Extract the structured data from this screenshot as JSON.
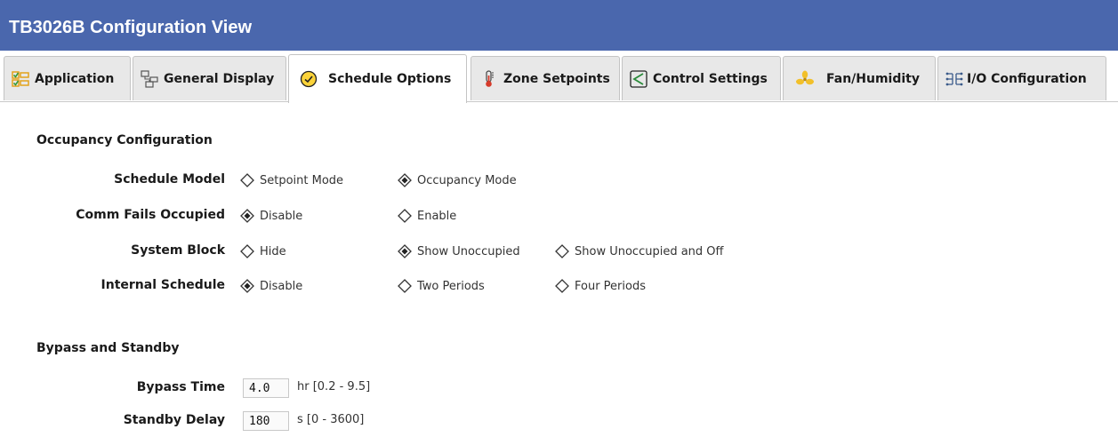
{
  "window": {
    "title": "TB3026B Configuration View"
  },
  "tabs": [
    {
      "label": "Application",
      "icon": "checklist-icon",
      "active": false
    },
    {
      "label": "General Display",
      "icon": "display-layout-icon",
      "active": false
    },
    {
      "label": "Schedule Options",
      "icon": "clock-check-icon",
      "active": true
    },
    {
      "label": "Zone Setpoints",
      "icon": "thermometer-icon",
      "active": false
    },
    {
      "label": "Control Settings",
      "icon": "control-arrow-icon",
      "active": false
    },
    {
      "label": "Fan/Humidity",
      "icon": "fan-icon",
      "active": false
    },
    {
      "label": "I/O Configuration",
      "icon": "io-network-icon",
      "active": false
    }
  ],
  "occupancy": {
    "title": "Occupancy Configuration",
    "rows": [
      {
        "label": "Schedule Model",
        "options": [
          "Setpoint Mode",
          "Occupancy Mode"
        ],
        "selected": 1
      },
      {
        "label": "Comm Fails Occupied",
        "options": [
          "Disable",
          "Enable"
        ],
        "selected": 0
      },
      {
        "label": "System Block",
        "options": [
          "Hide",
          "Show Unoccupied",
          "Show Unoccupied and Off"
        ],
        "selected": 1
      },
      {
        "label": "Internal Schedule",
        "options": [
          "Disable",
          "Two Periods",
          "Four Periods"
        ],
        "selected": 0
      }
    ]
  },
  "bypass": {
    "title": "Bypass and Standby",
    "fields": [
      {
        "label": "Bypass Time",
        "value": "4.0",
        "unit": "hr [0.2 - 9.5]"
      },
      {
        "label": "Standby Delay",
        "value": "180",
        "unit": "s [0 - 3600]"
      }
    ]
  },
  "colors": {
    "title_bar": "#4a67ad",
    "tab_bg": "#e8e8e8",
    "active_tab_bg": "#ffffff"
  }
}
